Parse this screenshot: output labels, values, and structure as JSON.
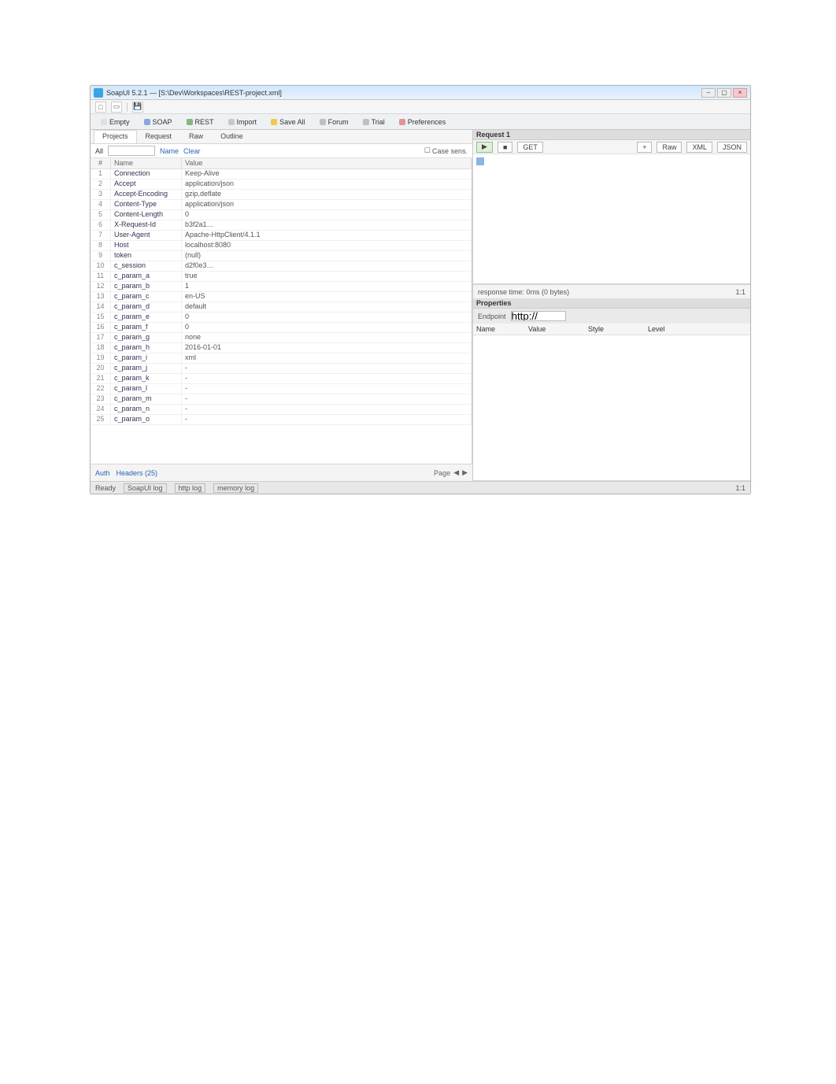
{
  "window": {
    "title": "SoapUI 5.2.1 — [S:\\Dev\\Workspaces\\REST-project.xml]"
  },
  "quickbar": {
    "btn_new": "□",
    "btn_open": "▭",
    "btn_save": "💾"
  },
  "ribbon": [
    {
      "label": "Empty",
      "color": "#e0e0e0"
    },
    {
      "label": "SOAP",
      "color": "#8aa8d8"
    },
    {
      "label": "REST",
      "color": "#7fb97f"
    },
    {
      "label": "Import",
      "color": "#c8c8c8"
    },
    {
      "label": "Save All",
      "color": "#f2c94c"
    },
    {
      "label": "Forum",
      "color": "#bfbfbf"
    },
    {
      "label": "Trial",
      "color": "#bfbfbf"
    },
    {
      "label": "Preferences",
      "color": "#e09696"
    }
  ],
  "left_tabs": [
    "Projects",
    "Request",
    "Raw",
    "Outline"
  ],
  "filter": {
    "label_filter": "All",
    "label_sort": "Name",
    "input_value": "",
    "chk_case": "Case sens.",
    "lnk_clear": "Clear"
  },
  "grid": {
    "headers": [
      "#",
      "Name",
      "Value"
    ],
    "rows": [
      [
        "1",
        "Connection",
        "Keep-Alive"
      ],
      [
        "2",
        "Accept",
        "application/json"
      ],
      [
        "3",
        "Accept-Encoding",
        "gzip,deflate"
      ],
      [
        "4",
        "Content-Type",
        "application/json"
      ],
      [
        "5",
        "Content-Length",
        "0"
      ],
      [
        "6",
        "X-Request-Id",
        "b3f2a1…"
      ],
      [
        "7",
        "User-Agent",
        "Apache-HttpClient/4.1.1"
      ],
      [
        "8",
        "Host",
        "localhost:8080"
      ],
      [
        "9",
        "token",
        "(null)"
      ],
      [
        "10",
        "c_session",
        "d2f0e3…"
      ],
      [
        "11",
        "c_param_a",
        "true"
      ],
      [
        "12",
        "c_param_b",
        "1"
      ],
      [
        "13",
        "c_param_c",
        "en-US"
      ],
      [
        "14",
        "c_param_d",
        "default"
      ],
      [
        "15",
        "c_param_e",
        "0"
      ],
      [
        "16",
        "c_param_f",
        "0"
      ],
      [
        "17",
        "c_param_g",
        "none"
      ],
      [
        "18",
        "c_param_h",
        "2016-01-01"
      ],
      [
        "19",
        "c_param_i",
        "xml"
      ],
      [
        "20",
        "c_param_j",
        "-"
      ],
      [
        "21",
        "c_param_k",
        "-"
      ],
      [
        "22",
        "c_param_l",
        "-"
      ],
      [
        "23",
        "c_param_m",
        "-"
      ],
      [
        "24",
        "c_param_n",
        "-"
      ],
      [
        "25",
        "c_param_o",
        "-"
      ]
    ]
  },
  "left_bot": {
    "lnk_auth": "Auth",
    "lnk_head": "Headers (25)",
    "pager_label": "Page"
  },
  "request_panel": {
    "title": "Request 1",
    "btn_run": "▶",
    "btn_stop": "■",
    "dd_method": "GET",
    "btn_add": "+",
    "btn_del": "✕",
    "lbl_raw": "Raw",
    "lbl_xml": "XML",
    "lbl_json": "JSON",
    "foot_left": "response time: 0ms (0 bytes)",
    "foot_right": "1:1"
  },
  "props_panel": {
    "title": "Properties",
    "tool_ep": "Endpoint",
    "tool_ep_v": "http://",
    "cols": [
      "Name",
      "Value",
      "Style",
      "Level"
    ]
  },
  "status": {
    "s1": "Ready",
    "s2": "SoapUI log",
    "s3": "http log",
    "s4": "memory log",
    "s5": "1:1"
  }
}
